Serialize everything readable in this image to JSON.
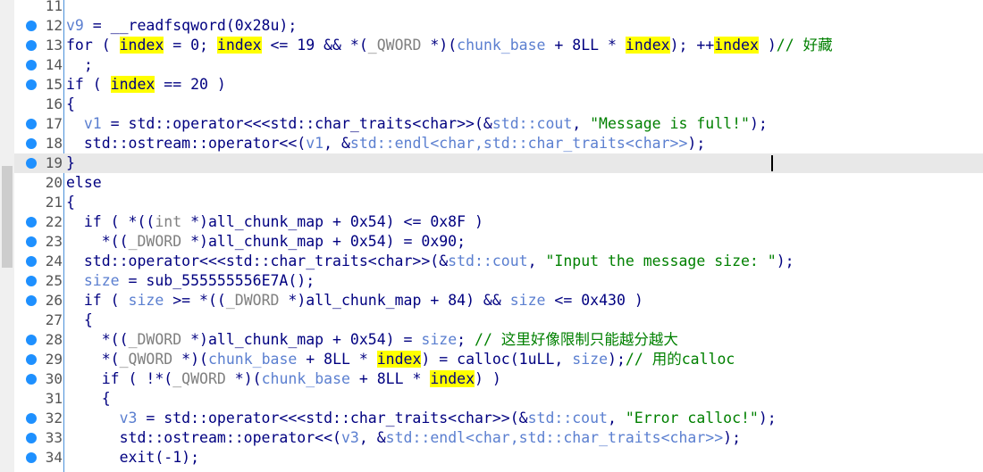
{
  "editor": {
    "lines": [
      {
        "n": "11",
        "bp": false,
        "current": false,
        "indent": "",
        "tokens": []
      },
      {
        "n": "12",
        "bp": true,
        "current": false,
        "indent": "",
        "tokens": [
          [
            "v",
            "v9"
          ],
          [
            "k",
            " = __readfsqword(0x28u);"
          ]
        ]
      },
      {
        "n": "13",
        "bp": true,
        "current": false,
        "indent": "",
        "tokens": [
          [
            "k",
            "for ( "
          ],
          [
            "h",
            "index"
          ],
          [
            "k",
            " = 0; "
          ],
          [
            "h",
            "index"
          ],
          [
            "k",
            " <= 19 && *("
          ],
          [
            "t",
            "_QWORD"
          ],
          [
            "k",
            " *)("
          ],
          [
            "v",
            "chunk_base"
          ],
          [
            "k",
            " + 8LL * "
          ],
          [
            "h",
            "index"
          ],
          [
            "k",
            "); ++"
          ],
          [
            "h",
            "index"
          ],
          [
            "k",
            " )"
          ],
          [
            "c",
            "// 好藏"
          ]
        ]
      },
      {
        "n": "14",
        "bp": true,
        "current": false,
        "indent": "  ",
        "tokens": [
          [
            "k",
            ";"
          ]
        ]
      },
      {
        "n": "15",
        "bp": true,
        "current": false,
        "indent": "",
        "tokens": [
          [
            "k",
            "if ( "
          ],
          [
            "h",
            "index"
          ],
          [
            "k",
            " == 20 )"
          ]
        ]
      },
      {
        "n": "16",
        "bp": false,
        "current": false,
        "indent": "",
        "tokens": [
          [
            "k",
            "{"
          ]
        ]
      },
      {
        "n": "17",
        "bp": true,
        "current": false,
        "indent": "  ",
        "tokens": [
          [
            "v",
            "v1"
          ],
          [
            "k",
            " = std::operator<<<std::char_traits<char>>(&"
          ],
          [
            "v",
            "std::cout"
          ],
          [
            "k",
            ", "
          ],
          [
            "s",
            "\"Message is full!\""
          ],
          [
            "k",
            ");"
          ]
        ]
      },
      {
        "n": "18",
        "bp": true,
        "current": false,
        "indent": "  ",
        "tokens": [
          [
            "k",
            "std::ostream::operator<<("
          ],
          [
            "v",
            "v1"
          ],
          [
            "k",
            ", &"
          ],
          [
            "v",
            "std::endl<char,std::char_traits<char>>"
          ],
          [
            "k",
            ");"
          ]
        ]
      },
      {
        "n": "19",
        "bp": true,
        "current": true,
        "indent": "",
        "tokens": [
          [
            "k",
            "}"
          ]
        ]
      },
      {
        "n": "20",
        "bp": false,
        "current": false,
        "indent": "",
        "tokens": [
          [
            "k",
            "else"
          ]
        ]
      },
      {
        "n": "21",
        "bp": false,
        "current": false,
        "indent": "",
        "tokens": [
          [
            "k",
            "{"
          ]
        ]
      },
      {
        "n": "22",
        "bp": true,
        "current": false,
        "indent": "  ",
        "tokens": [
          [
            "k",
            "if ( *(("
          ],
          [
            "t",
            "int"
          ],
          [
            "k",
            " *)all_chunk_map + 0x54) <= 0x8F )"
          ]
        ]
      },
      {
        "n": "23",
        "bp": true,
        "current": false,
        "indent": "    ",
        "tokens": [
          [
            "k",
            "*(("
          ],
          [
            "t",
            "_DWORD"
          ],
          [
            "k",
            " *)all_chunk_map + 0x54) = 0x90;"
          ]
        ]
      },
      {
        "n": "24",
        "bp": true,
        "current": false,
        "indent": "  ",
        "tokens": [
          [
            "k",
            "std::operator<<<std::char_traits<char>>(&"
          ],
          [
            "v",
            "std::cout"
          ],
          [
            "k",
            ", "
          ],
          [
            "s",
            "\"Input the message size: \""
          ],
          [
            "k",
            ");"
          ]
        ]
      },
      {
        "n": "25",
        "bp": true,
        "current": false,
        "indent": "  ",
        "tokens": [
          [
            "v",
            "size"
          ],
          [
            "k",
            " = sub_555555556E7A();"
          ]
        ]
      },
      {
        "n": "26",
        "bp": true,
        "current": false,
        "indent": "  ",
        "tokens": [
          [
            "k",
            "if ( "
          ],
          [
            "v",
            "size"
          ],
          [
            "k",
            " >= *(("
          ],
          [
            "t",
            "_DWORD"
          ],
          [
            "k",
            " *)all_chunk_map + 84) && "
          ],
          [
            "v",
            "size"
          ],
          [
            "k",
            " <= 0x430 )"
          ]
        ]
      },
      {
        "n": "27",
        "bp": false,
        "current": false,
        "indent": "  ",
        "tokens": [
          [
            "k",
            "{"
          ]
        ]
      },
      {
        "n": "28",
        "bp": true,
        "current": false,
        "indent": "    ",
        "tokens": [
          [
            "k",
            "*(("
          ],
          [
            "t",
            "_DWORD"
          ],
          [
            "k",
            " *)all_chunk_map + 0x54) = "
          ],
          [
            "v",
            "size"
          ],
          [
            "k",
            "; "
          ],
          [
            "c",
            "// 这里好像限制只能越分越大"
          ]
        ]
      },
      {
        "n": "29",
        "bp": true,
        "current": false,
        "indent": "    ",
        "tokens": [
          [
            "k",
            "*("
          ],
          [
            "t",
            "_QWORD"
          ],
          [
            "k",
            " *)("
          ],
          [
            "v",
            "chunk_base"
          ],
          [
            "k",
            " + 8LL * "
          ],
          [
            "h",
            "index"
          ],
          [
            "k",
            ") = calloc(1uLL, "
          ],
          [
            "v",
            "size"
          ],
          [
            "k",
            ");"
          ],
          [
            "c",
            "// 用的calloc"
          ]
        ]
      },
      {
        "n": "30",
        "bp": true,
        "current": false,
        "indent": "    ",
        "tokens": [
          [
            "k",
            "if ( !*("
          ],
          [
            "t",
            "_QWORD"
          ],
          [
            "k",
            " *)("
          ],
          [
            "v",
            "chunk_base"
          ],
          [
            "k",
            " + 8LL * "
          ],
          [
            "h",
            "index"
          ],
          [
            "k",
            ") )"
          ]
        ]
      },
      {
        "n": "31",
        "bp": false,
        "current": false,
        "indent": "    ",
        "tokens": [
          [
            "k",
            "{"
          ]
        ]
      },
      {
        "n": "32",
        "bp": true,
        "current": false,
        "indent": "      ",
        "tokens": [
          [
            "v",
            "v3"
          ],
          [
            "k",
            " = std::operator<<<std::char_traits<char>>(&"
          ],
          [
            "v",
            "std::cout"
          ],
          [
            "k",
            ", "
          ],
          [
            "s",
            "\"Error calloc!\""
          ],
          [
            "k",
            ");"
          ]
        ]
      },
      {
        "n": "33",
        "bp": true,
        "current": false,
        "indent": "      ",
        "tokens": [
          [
            "k",
            "std::ostream::operator<<("
          ],
          [
            "v",
            "v3"
          ],
          [
            "k",
            ", &"
          ],
          [
            "v",
            "std::endl<char,std::char_traits<char>>"
          ],
          [
            "k",
            ");"
          ]
        ]
      },
      {
        "n": "34",
        "bp": true,
        "current": false,
        "indent": "      ",
        "tokens": [
          [
            "k",
            "exit(-1);"
          ]
        ]
      }
    ]
  }
}
